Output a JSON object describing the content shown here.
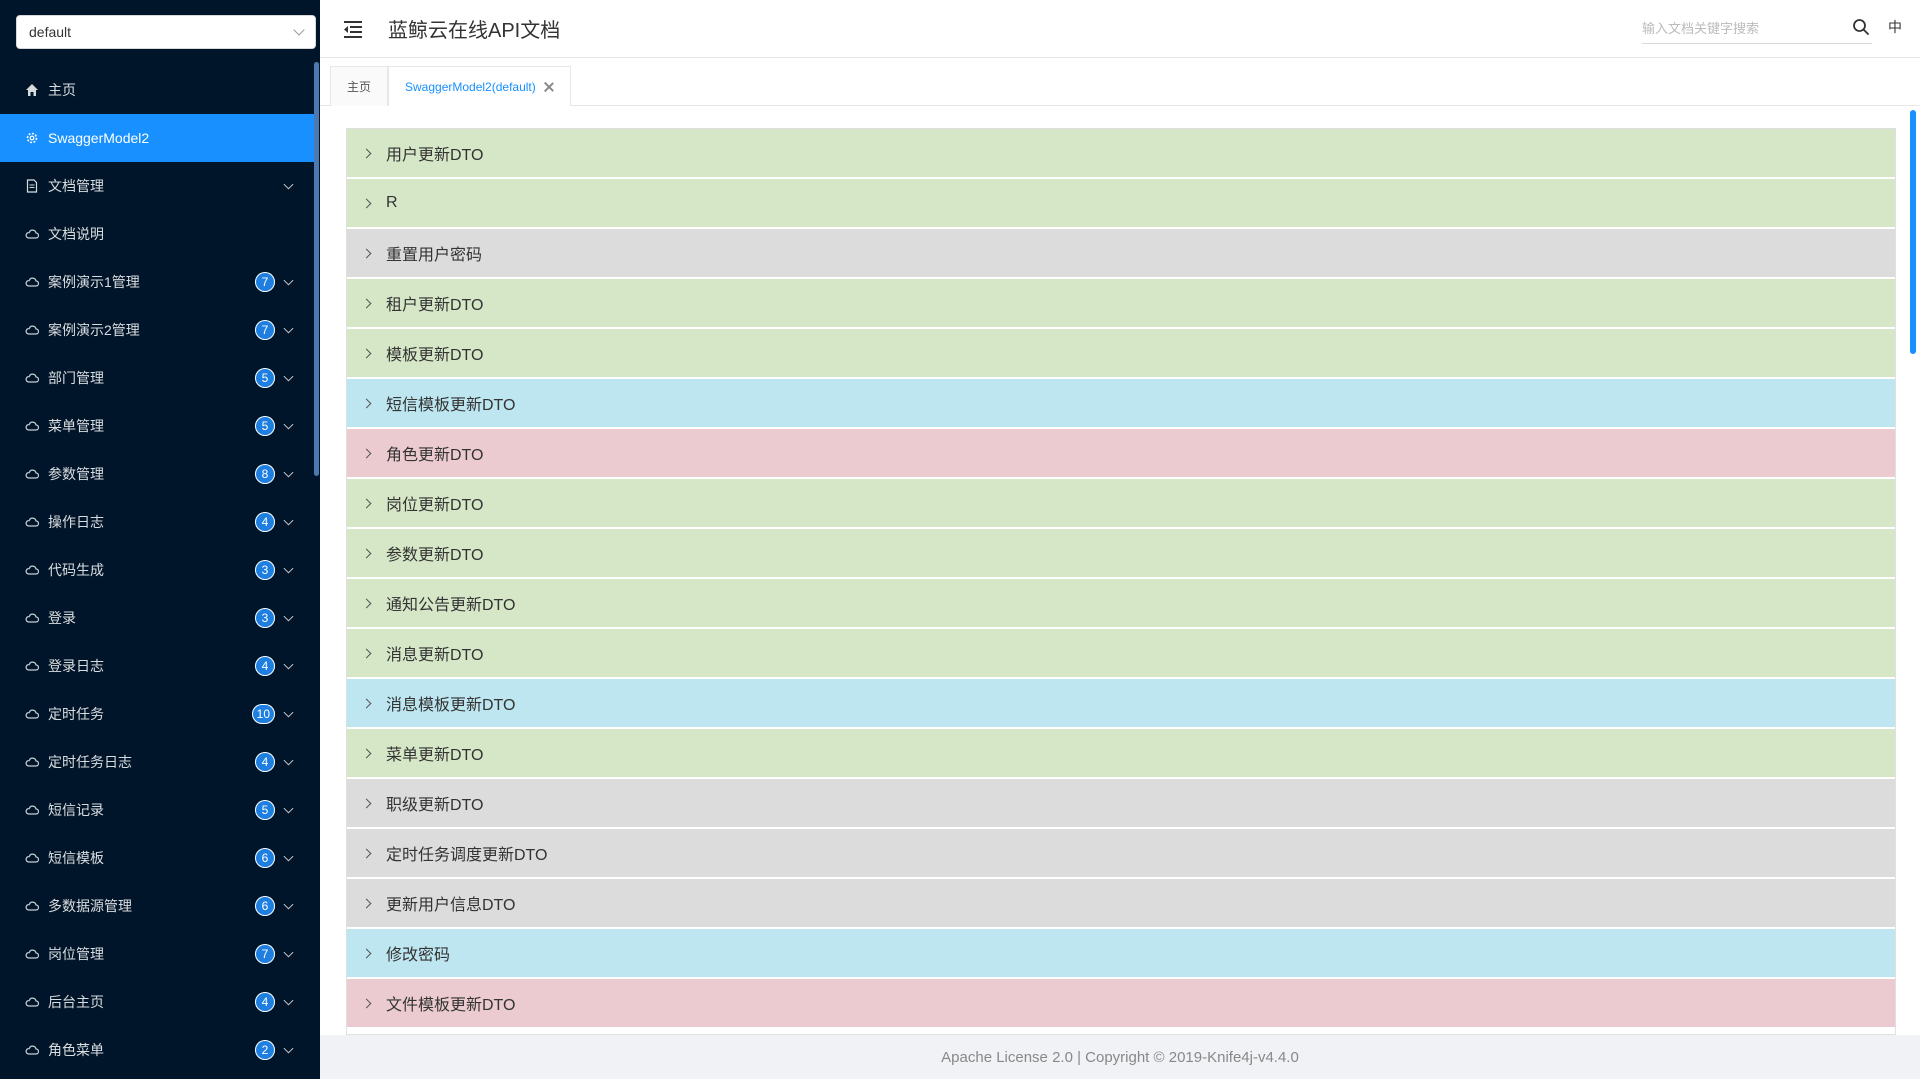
{
  "sidebar": {
    "group_select": "default",
    "items": [
      {
        "label": "主页",
        "icon": "home-icon",
        "badge": "",
        "expandable": false,
        "active": false
      },
      {
        "label": "SwaggerModel2",
        "icon": "gear-icon",
        "badge": "",
        "expandable": false,
        "active": true
      },
      {
        "label": "文档管理",
        "icon": "document-icon",
        "badge": "",
        "expandable": true,
        "active": false
      },
      {
        "label": "文档说明",
        "icon": "cloud-icon",
        "badge": "",
        "expandable": false,
        "active": false
      },
      {
        "label": "案例演示1管理",
        "icon": "cloud-icon",
        "badge": "7",
        "expandable": true,
        "active": false
      },
      {
        "label": "案例演示2管理",
        "icon": "cloud-icon",
        "badge": "7",
        "expandable": true,
        "active": false
      },
      {
        "label": "部门管理",
        "icon": "cloud-icon",
        "badge": "5",
        "expandable": true,
        "active": false
      },
      {
        "label": "菜单管理",
        "icon": "cloud-icon",
        "badge": "5",
        "expandable": true,
        "active": false
      },
      {
        "label": "参数管理",
        "icon": "cloud-icon",
        "badge": "8",
        "expandable": true,
        "active": false
      },
      {
        "label": "操作日志",
        "icon": "cloud-icon",
        "badge": "4",
        "expandable": true,
        "active": false
      },
      {
        "label": "代码生成",
        "icon": "cloud-icon",
        "badge": "3",
        "expandable": true,
        "active": false
      },
      {
        "label": "登录",
        "icon": "cloud-icon",
        "badge": "3",
        "expandable": true,
        "active": false
      },
      {
        "label": "登录日志",
        "icon": "cloud-icon",
        "badge": "4",
        "expandable": true,
        "active": false
      },
      {
        "label": "定时任务",
        "icon": "cloud-icon",
        "badge": "10",
        "expandable": true,
        "active": false
      },
      {
        "label": "定时任务日志",
        "icon": "cloud-icon",
        "badge": "4",
        "expandable": true,
        "active": false
      },
      {
        "label": "短信记录",
        "icon": "cloud-icon",
        "badge": "5",
        "expandable": true,
        "active": false
      },
      {
        "label": "短信模板",
        "icon": "cloud-icon",
        "badge": "6",
        "expandable": true,
        "active": false
      },
      {
        "label": "多数据源管理",
        "icon": "cloud-icon",
        "badge": "6",
        "expandable": true,
        "active": false
      },
      {
        "label": "岗位管理",
        "icon": "cloud-icon",
        "badge": "7",
        "expandable": true,
        "active": false
      },
      {
        "label": "后台主页",
        "icon": "cloud-icon",
        "badge": "4",
        "expandable": true,
        "active": false
      },
      {
        "label": "角色菜单",
        "icon": "cloud-icon",
        "badge": "2",
        "expandable": true,
        "active": false
      }
    ]
  },
  "header": {
    "title": "蓝鲸云在线API文档",
    "search_placeholder": "输入文档关键字搜索",
    "lang": "中"
  },
  "tabs": [
    {
      "label": "主页",
      "active": false,
      "closable": false
    },
    {
      "label": "SwaggerModel2(default)",
      "active": true,
      "closable": true
    }
  ],
  "models": [
    {
      "label": "用户更新DTO",
      "color": "green"
    },
    {
      "label": "R",
      "color": "green"
    },
    {
      "label": "重置用户密码",
      "color": "gray"
    },
    {
      "label": "租户更新DTO",
      "color": "green"
    },
    {
      "label": "模板更新DTO",
      "color": "green"
    },
    {
      "label": "短信模板更新DTO",
      "color": "blue"
    },
    {
      "label": "角色更新DTO",
      "color": "pink"
    },
    {
      "label": "岗位更新DTO",
      "color": "green"
    },
    {
      "label": "参数更新DTO",
      "color": "green"
    },
    {
      "label": "通知公告更新DTO",
      "color": "green"
    },
    {
      "label": "消息更新DTO",
      "color": "green"
    },
    {
      "label": "消息模板更新DTO",
      "color": "blue"
    },
    {
      "label": "菜单更新DTO",
      "color": "green"
    },
    {
      "label": "职级更新DTO",
      "color": "gray"
    },
    {
      "label": "定时任务调度更新DTO",
      "color": "gray"
    },
    {
      "label": "更新用户信息DTO",
      "color": "gray"
    },
    {
      "label": "修改密码",
      "color": "blue"
    },
    {
      "label": "文件模板更新DTO",
      "color": "pink"
    }
  ],
  "colors": {
    "green": "#d6e7c7",
    "gray": "#dcdcdc",
    "blue": "#bde6f0",
    "pink": "#ebcbd0",
    "accent": "#1890ff",
    "sidebar_bg": "#001529"
  },
  "footer": {
    "text": "Apache License 2.0 | Copyright © 2019-Knife4j-v4.4.0"
  }
}
